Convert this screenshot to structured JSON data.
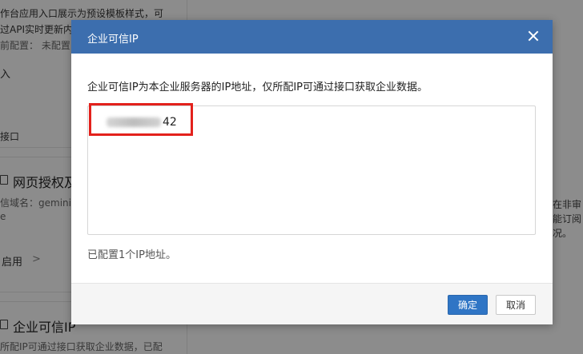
{
  "background": {
    "card1": {
      "line1": "作台应用入口展示为预设模板样式，可",
      "line2": "过API实时更新内",
      "line3": "前配置： 未配置",
      "link": "入",
      "footer_text": "接口"
    },
    "card2": {
      "title": "网页授权及",
      "line1": "信域名：gemini-",
      "line2": "e",
      "status": "启用",
      "chevron": ">"
    },
    "card3": {
      "title": "企业可信IP",
      "line1": "所配IP可通过接口获取企业数据，已配"
    },
    "right_text": {
      "line1": "在非审",
      "line2": "能订阅",
      "line3": "况。"
    }
  },
  "modal": {
    "title": "企业可信IP",
    "description": "企业可信IP为本企业服务器的IP地址，仅所配IP可通过接口获取企业数据。",
    "ip_value_visible_suffix": "42",
    "configured_count": "已配置1个IP地址。",
    "confirm_label": "确定",
    "cancel_label": "取消"
  },
  "colors": {
    "header_bg": "#3c6eae",
    "confirm_bg": "#2f75c5",
    "highlight": "#e3211c"
  }
}
